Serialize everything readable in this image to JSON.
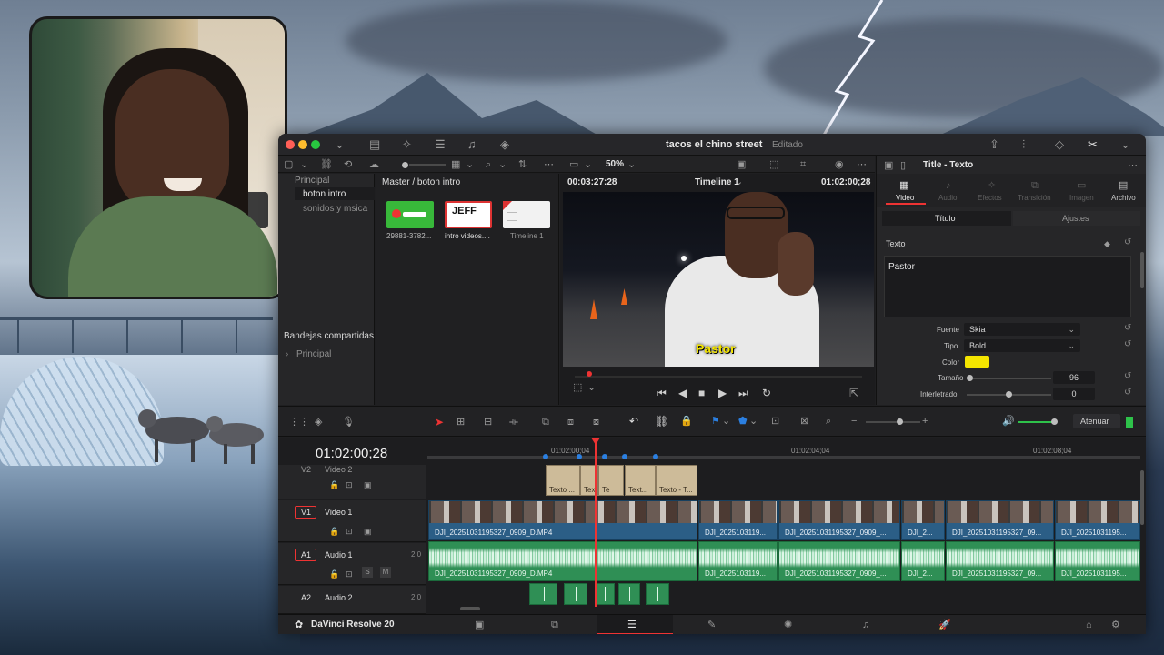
{
  "window": {
    "project": "tacos el chino street",
    "status": "Editado"
  },
  "bins": {
    "header": "Principal",
    "items": [
      "boton intro",
      "sonidos y msica"
    ],
    "shared_header": "Bandejas compartidas",
    "shared_item": "Principal"
  },
  "media": {
    "path": "Master / boton intro",
    "clips": [
      {
        "label": "29881-3782..."
      },
      {
        "label": "intro videos....",
        "thumb_text": "JEFF"
      },
      {
        "label": "Timeline 1"
      }
    ]
  },
  "viewer": {
    "zoom": "50%",
    "source_tc": "00:03:27:28",
    "timeline": "Timeline 1",
    "record_tc": "01:02:00;28",
    "caption": "Pastor"
  },
  "inspector": {
    "title": "Title - Texto",
    "tabs": [
      "Video",
      "Audio",
      "Efectos",
      "Transición",
      "Imagen",
      "Archivo"
    ],
    "subtabs": [
      "Título",
      "Ajustes"
    ],
    "section": "Texto",
    "text_value": "Pastor",
    "labels": {
      "font": "Fuente",
      "style": "Tipo",
      "color": "Color",
      "size": "Tamaño",
      "tracking": "Interletrado"
    },
    "font": "Skia",
    "style": "Bold",
    "color_hex": "#f4e500",
    "size": "96",
    "tracking": "0"
  },
  "timeline": {
    "timecode": "01:02:00;28",
    "ruler": [
      "01:02:00;04",
      "01:02:04;04",
      "01:02:08;04"
    ],
    "atenuar": "Atenuar",
    "tracks": {
      "v2": {
        "id": "V2",
        "name": "Video 2"
      },
      "v1": {
        "id": "V1",
        "name": "Video 1"
      },
      "a1": {
        "id": "A1",
        "name": "Audio 1",
        "ch": "2.0"
      },
      "a2": {
        "id": "A2",
        "name": "Audio 2",
        "ch": "2.0"
      }
    },
    "titles": [
      "Texto ...",
      "Tex",
      "Te",
      "Text...",
      "Texto - T..."
    ],
    "v1_clips": [
      "DJI_20251031195327_0909_D.MP4",
      "DJI_2025103119...",
      "DJI_20251031195327_0909_...",
      "DJI_2...",
      "DJI_20251031195327_09...",
      "DJI_20251031195..."
    ],
    "a1_clips": [
      "DJI_20251031195327_0909_D.MP4",
      "DJI_2025103119...",
      "DJI_20251031195327_0909_...",
      "DJI_2...",
      "DJI_20251031195327_09...",
      "DJI_20251031195..."
    ]
  },
  "app": {
    "name": "DaVinci Resolve 20"
  }
}
